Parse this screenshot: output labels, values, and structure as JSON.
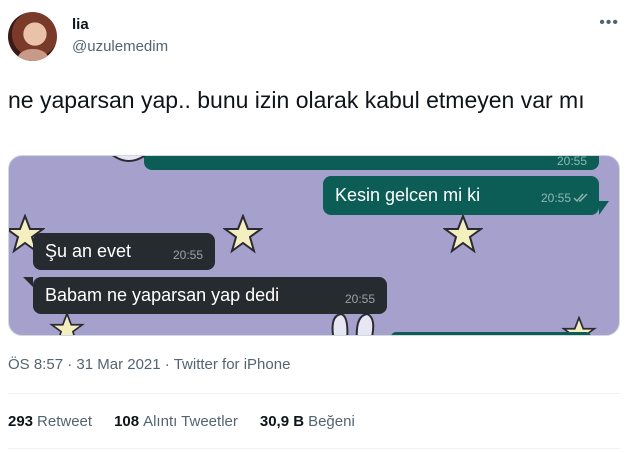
{
  "user": {
    "name": "lia",
    "handle": "@uzulemedim"
  },
  "tweet": {
    "text": "ne yaparsan yap.. bunu izin olarak kabul etmeyen var mı",
    "time": "ÖS 8:57",
    "date": "31 Mar 2021",
    "source": "Twitter for iPhone",
    "separator": "·"
  },
  "chat": {
    "top_partial_time": "20:55",
    "messages": [
      {
        "text": "Kesin gelcen mi ki",
        "time": "20:55",
        "status": "read-checks",
        "direction": "out"
      },
      {
        "text": "Şu an evet",
        "time": "20:55",
        "direction": "in"
      },
      {
        "text": "Babam ne yaparsan yap dedi",
        "time": "20:55",
        "direction": "in"
      }
    ]
  },
  "stats": {
    "retweets": {
      "count": "293",
      "label": "Retweet"
    },
    "quotes": {
      "count": "108",
      "label": "Alıntı Tweetler"
    },
    "likes": {
      "count": "30,9 B",
      "label": "Beğeni"
    }
  },
  "colors": {
    "wallpaper": "#a6a0cc",
    "outgoing_bubble": "#0b5d55",
    "incoming_bubble": "#262b2f",
    "secondary_text": "#536471"
  },
  "icons": {
    "more": "more-horizontal-icon",
    "read_receipt": "double-check-icon",
    "wallpaper_star": "star-icon"
  }
}
